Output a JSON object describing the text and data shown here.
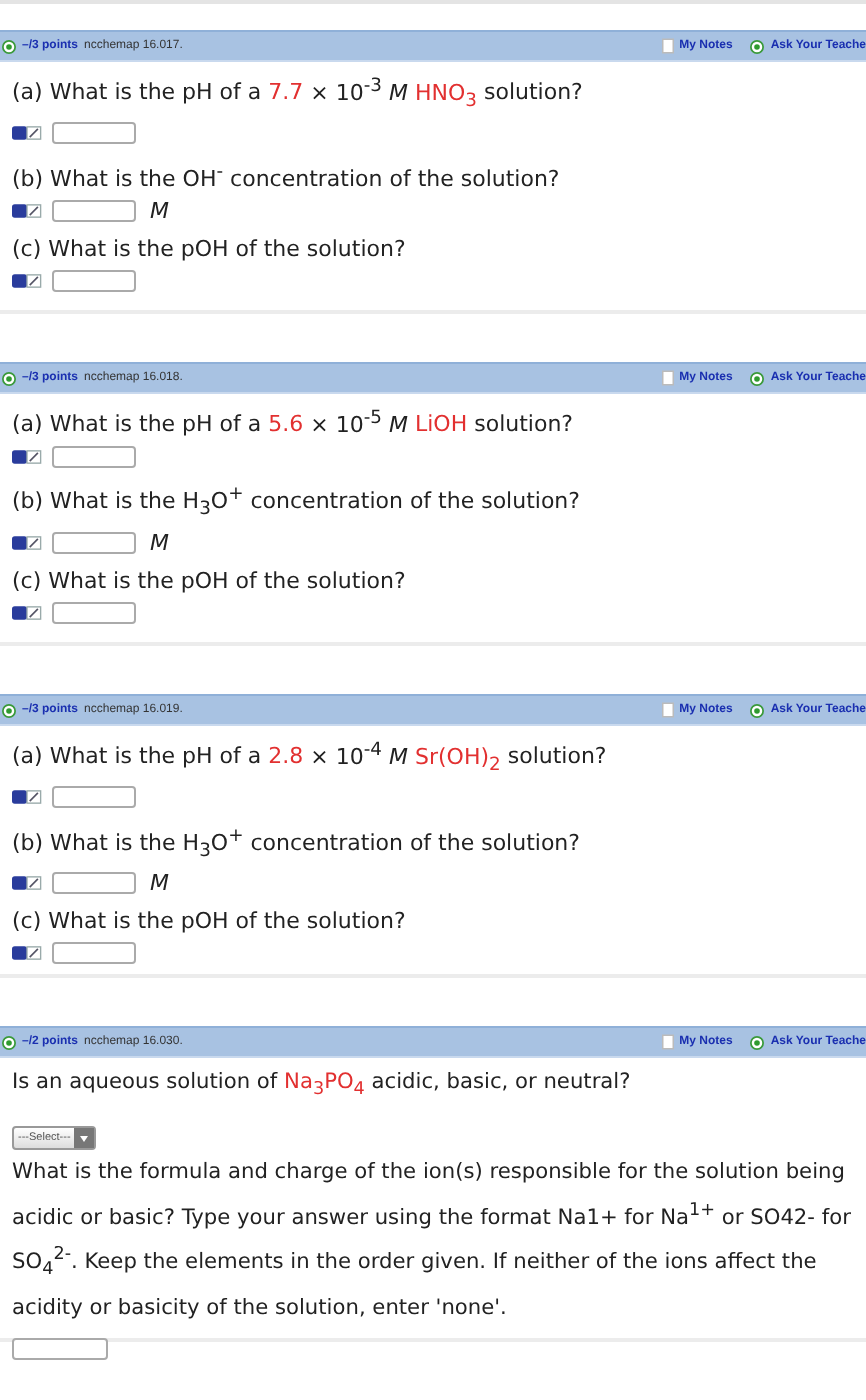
{
  "problems": [
    {
      "points": "–/3 points",
      "code": "ncchemap 16.017.",
      "notes": "My Notes",
      "ask": "Ask Your Teache",
      "parts": [
        {
          "kind": "numeric",
          "question": [
            {
              "text": "(a) What is the pH of a ",
              "red": false
            },
            {
              "text": "7.7",
              "red": true
            },
            {
              "text": " × 10$^{-3}$ *M* ",
              "red": false
            },
            {
              "text": "HNO$_{3}$",
              "red": true
            },
            {
              "text": " solution?",
              "red": false
            }
          ]
        },
        {
          "kind": "numeric",
          "question": [
            {
              "text": "(b) What is the OH$^{-}$ concentration of the solution?",
              "red": false
            }
          ],
          "unit": "M"
        },
        {
          "kind": "numeric",
          "question": [
            {
              "text": "(c) What is the pOH of the solution?",
              "red": false
            }
          ]
        }
      ]
    },
    {
      "points": "–/3 points",
      "code": "ncchemap 16.018.",
      "notes": "My Notes",
      "ask": "Ask Your Teache",
      "parts": [
        {
          "kind": "numeric",
          "question": [
            {
              "text": "(a) What is the pH of a ",
              "red": false
            },
            {
              "text": "5.6",
              "red": true
            },
            {
              "text": " × 10$^{-5}$ *M* ",
              "red": false
            },
            {
              "text": "LiOH",
              "red": true
            },
            {
              "text": " solution?",
              "red": false
            }
          ]
        },
        {
          "kind": "numeric",
          "question": [
            {
              "text": "(b) What is the H$_{3}$O$^{+}$ concentration of the solution?",
              "red": false
            }
          ],
          "unit": "M"
        },
        {
          "kind": "numeric",
          "question": [
            {
              "text": "(c) What is the pOH of the solution?",
              "red": false
            }
          ]
        }
      ]
    },
    {
      "points": "–/3 points",
      "code": "ncchemap 16.019.",
      "notes": "My Notes",
      "ask": "Ask Your Teache",
      "parts": [
        {
          "kind": "numeric",
          "question": [
            {
              "text": "(a) What is the pH of a ",
              "red": false
            },
            {
              "text": "2.8",
              "red": true
            },
            {
              "text": " × 10$^{-4}$ *M* ",
              "red": false
            },
            {
              "text": "Sr(OH)$_{2}$",
              "red": true
            },
            {
              "text": " solution?",
              "red": false
            }
          ]
        },
        {
          "kind": "numeric",
          "question": [
            {
              "text": "(b) What is the H$_{3}$O$^{+}$ concentration of the solution?",
              "red": false
            }
          ],
          "unit": "M"
        },
        {
          "kind": "numeric",
          "question": [
            {
              "text": "(c) What is the pOH of the solution?",
              "red": false
            }
          ]
        }
      ]
    },
    {
      "points": "–/2 points",
      "code": "ncchemap 16.030.",
      "notes": "My Notes",
      "ask": "Ask Your Teache",
      "parts": [
        {
          "kind": "text",
          "question": [
            {
              "text": "Is an aqueous solution of ",
              "red": false
            },
            {
              "text": "Na$_{3}$PO$_{4}$",
              "red": true
            },
            {
              "text": " acidic, basic, or neutral?",
              "red": false
            }
          ]
        },
        {
          "kind": "select",
          "placeholder": "---Select---"
        },
        {
          "kind": "text",
          "question": [
            {
              "text": "What is the formula and charge of the ion(s) responsible for the solution being acidic or basic? Type your answer using the format Na1+ for Na$^{1+}$ or SO42- for SO$_{4}$$^{2-}$. Keep the elements in the order given. If neither of the ions affect the acidity or basicity of the solution, enter 'none'.",
              "red": false
            }
          ]
        },
        {
          "kind": "input"
        }
      ]
    }
  ]
}
